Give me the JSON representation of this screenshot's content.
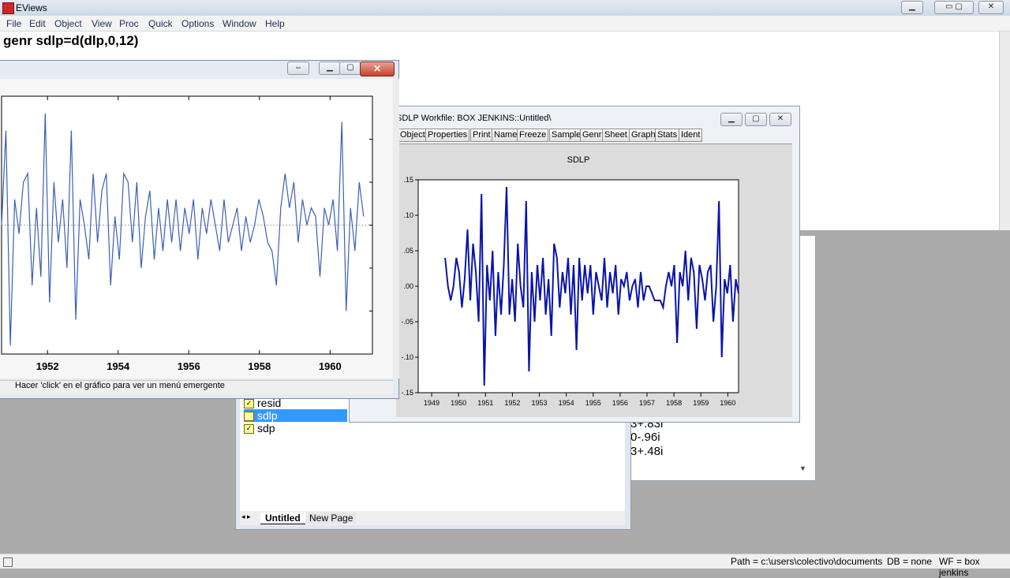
{
  "app": {
    "title": "EViews"
  },
  "menu": [
    "File",
    "Edit",
    "Object",
    "View",
    "Proc",
    "Quick",
    "Options",
    "Window",
    "Help"
  ],
  "command": "genr sdlp=d(dlp,0,12)",
  "status": {
    "path": "Path = c:\\users\\colectivo\\documents",
    "db": "DB = none",
    "wf": "WF = box jenkins"
  },
  "equation_values": [
    "3+.83i",
    "0-.96i",
    "3+.48i"
  ],
  "workfile": {
    "items": [
      "resid",
      "sdlp",
      "sdp"
    ],
    "selected": "sdlp",
    "tabs": [
      "Untitled",
      "New Page"
    ]
  },
  "graph_window": {
    "title": "SDLP   Workfile: BOX JENKINS::Untitled\\",
    "toolbar": [
      "Object",
      "Properties",
      "Print",
      "Name",
      "Freeze",
      "Sample",
      "Genr",
      "Sheet",
      "Graph",
      "Stats",
      "Ident"
    ]
  },
  "front_window": {
    "status": "Hacer 'click' en el gráfico para ver un menú emergente",
    "close_label": "✕"
  },
  "colors": {
    "series_main": "#0a14a8",
    "series_front": "#3c5fb5",
    "selection": "#3399ff"
  },
  "chart_data": [
    {
      "type": "line",
      "title": "SDLP",
      "xlabel": "",
      "ylabel": "",
      "x_tick_labels": [
        "1949",
        "1950",
        "1951",
        "1952",
        "1953",
        "1954",
        "1955",
        "1956",
        "1957",
        "1958",
        "1959",
        "1960"
      ],
      "y_tick_labels": [
        ".15",
        ".10",
        ".05",
        ".00",
        "-.05",
        "-.10",
        "-.15"
      ],
      "ylim": [
        -0.15,
        0.15
      ],
      "xlim": [
        1949,
        1960.9
      ],
      "series": [
        {
          "values": [
            0.04,
            0.0,
            -0.02,
            0.0,
            0.04,
            0.02,
            -0.03,
            0.01,
            0.08,
            -0.02,
            0.06,
            0.02,
            -0.05,
            0.13,
            -0.14,
            0.03,
            -0.02,
            0.05,
            -0.07,
            0.02,
            -0.04,
            0.03,
            0.14,
            -0.04,
            0.01,
            -0.05,
            0.06,
            0.0,
            -0.03,
            0.12,
            -0.12,
            0.02,
            -0.05,
            0.03,
            -0.02,
            0.04,
            -0.04,
            0.01,
            -0.07,
            0.06,
            0.04,
            -0.03,
            0.02,
            -0.01,
            0.04,
            -0.04,
            0.03,
            -0.09,
            0.04,
            -0.02,
            0.03,
            -0.01,
            0.03,
            -0.04,
            0.02,
            0.0,
            -0.02,
            0.04,
            -0.03,
            0.02,
            -0.01,
            0.03,
            -0.04,
            0.01,
            0.0,
            0.02,
            -0.02,
            0.0,
            0.01,
            -0.03,
            0.02,
            -0.02,
            0.0,
            0.0,
            -0.01,
            -0.02,
            -0.02,
            -0.02,
            -0.03,
            0.0,
            0.02,
            0.0,
            0.03,
            -0.08,
            0.02,
            0.0,
            0.05,
            -0.02,
            0.04,
            0.02,
            -0.06,
            0.03,
            0.01,
            -0.02,
            0.02,
            0.03,
            -0.05,
            0.0,
            0.12,
            -0.1,
            0.01,
            -0.01,
            0.03,
            -0.05,
            0.01,
            -0.01
          ]
        }
      ]
    },
    {
      "type": "line",
      "title": "",
      "xlabel": "",
      "ylabel": "",
      "x_tick_labels": [
        "1952",
        "1954",
        "1956",
        "1958",
        "1960"
      ],
      "xlim": [
        1950.7,
        1961.2
      ],
      "ylim": [
        -0.15,
        0.15
      ],
      "series": [
        {
          "values": [
            0.0,
            0.11,
            -0.14,
            0.03,
            -0.01,
            0.05,
            0.06,
            -0.07,
            0.02,
            -0.06,
            0.13,
            -0.09,
            0.05,
            -0.02,
            0.03,
            -0.05,
            0.11,
            -0.11,
            0.03,
            0.0,
            -0.04,
            0.06,
            -0.02,
            0.04,
            0.06,
            -0.07,
            0.01,
            -0.04,
            0.06,
            0.05,
            -0.02,
            0.05,
            -0.05,
            0.01,
            0.04,
            -0.04,
            0.02,
            -0.03,
            0.03,
            -0.02,
            0.03,
            -0.03,
            0.02,
            -0.01,
            0.03,
            -0.04,
            0.02,
            -0.01,
            0.03,
            0.0,
            -0.03,
            0.03,
            -0.02,
            0.0,
            0.02,
            -0.03,
            0.01,
            -0.02,
            0.0,
            0.03,
            0.01,
            -0.02,
            -0.03,
            -0.07,
            0.02,
            0.06,
            0.02,
            0.05,
            -0.02,
            0.03,
            0.0,
            0.02,
            0.01,
            -0.06,
            0.02,
            0.0,
            0.03,
            -0.03,
            0.12,
            -0.1,
            0.02,
            -0.03,
            0.05,
            0.01
          ]
        }
      ]
    }
  ]
}
